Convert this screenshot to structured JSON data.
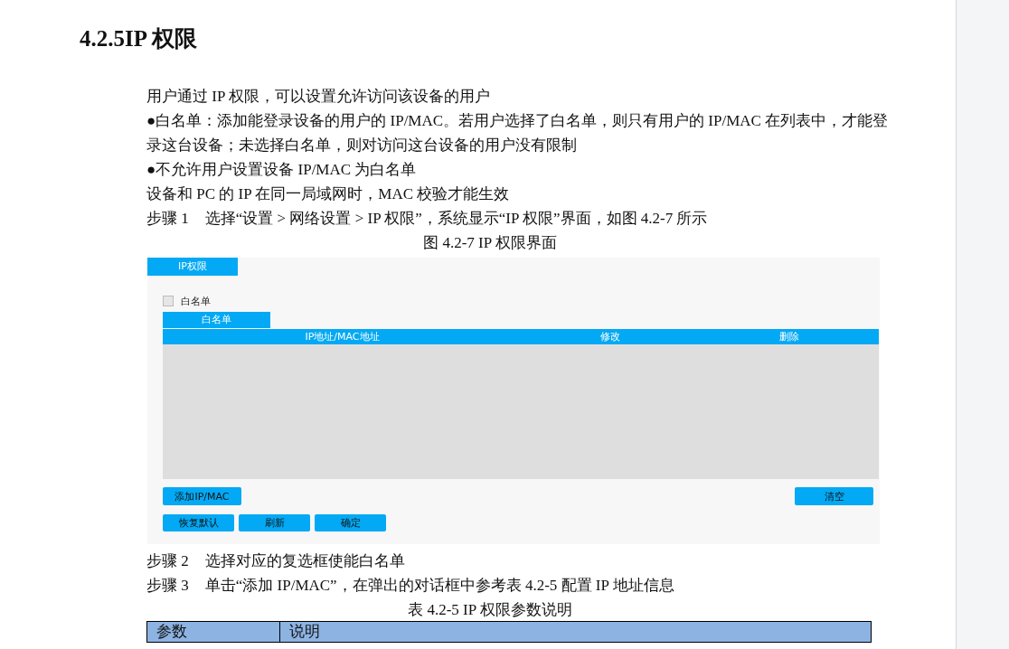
{
  "heading": "4.2.5IP 权限",
  "paragraphs": [
    "用户通过 IP 权限，可以设置允许访问该设备的用户",
    "●白名单：添加能登录设备的用户的 IP/MAC。若用户选择了白名单，则只有用户的 IP/MAC 在列表中，才能登录这台设备；未选择白名单，则对访问这台设备的用户没有限制",
    "●不允许用户设置设备 IP/MAC 为白名单",
    "设备和 PC 的 IP 在同一局域网时，MAC 校验才能生效"
  ],
  "steps_before": [
    {
      "label": "步骤 1",
      "text": "选择“设置 > 网络设置 > IP 权限”，系统显示“IP 权限”界面，如图 4.2-7 所示"
    }
  ],
  "figure_caption": "图 4.2-7 IP 权限界面",
  "figure": {
    "tab": "IP权限",
    "checkbox": {
      "label": "白名单",
      "checked": false
    },
    "subtab": "白名单",
    "columns": [
      "IP地址/MAC地址",
      "修改",
      "删除"
    ],
    "buttons_left": [
      "添加IP/MAC"
    ],
    "buttons_right": [
      "清空"
    ],
    "buttons_bottom": [
      "恢复默认",
      "刷新",
      "确定"
    ]
  },
  "steps_after": [
    {
      "label": "步骤 2",
      "text": "选择对应的复选框使能白名单"
    },
    {
      "label": "步骤 3",
      "text": "单击“添加 IP/MAC”，在弹出的对话框中参考表 4.2-5 配置 IP 地址信息"
    }
  ],
  "table_caption": "表 4.2-5 IP 权限参数说明",
  "table_columns": [
    "参数",
    "说明"
  ]
}
